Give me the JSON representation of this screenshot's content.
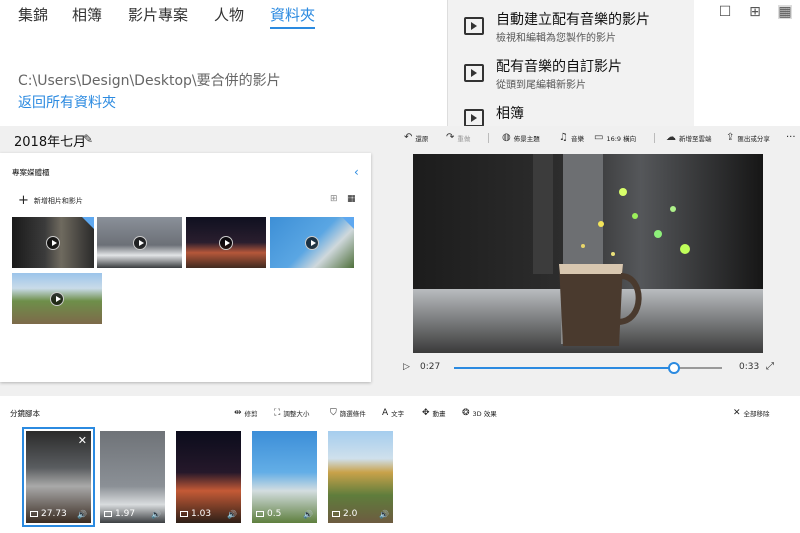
{
  "nav": {
    "tabs": [
      {
        "label": "集錦"
      },
      {
        "label": "相簿"
      },
      {
        "label": "影片專案"
      },
      {
        "label": "人物"
      },
      {
        "label": "資料夾"
      }
    ],
    "view_icons": [
      "square-view-icon",
      "grid-view-icon",
      "dense-grid-view-icon"
    ]
  },
  "folder": {
    "path": "C:\\Users\\Design\\Desktop\\要合併的影片",
    "back_label": "返回所有資料夾"
  },
  "menu": {
    "items": [
      {
        "title": "自動建立配有音樂的影片",
        "subtitle": "檢視和編輯為您製作的影片"
      },
      {
        "title": "配有音樂的自訂影片",
        "subtitle": "從頭到尾編輯新影片"
      },
      {
        "title": "相簿",
        "subtitle": ""
      }
    ]
  },
  "editor": {
    "project_title": "2018年七月",
    "toolbar": {
      "undo": "還原",
      "redo": "重做",
      "theme": "佈景主題",
      "music": "音樂",
      "aspect": "16:9 橫向",
      "cloud": "新增至雲端",
      "export": "匯出或分享",
      "more": "···"
    }
  },
  "library": {
    "title": "專案媒體櫃",
    "add_label": "新增相片和影片"
  },
  "player": {
    "current_time": "0:27",
    "end_time": "0:33",
    "progress": 0.82
  },
  "storyboard": {
    "title": "分鏡腳本",
    "tools": {
      "trim": "修剪",
      "resize": "調整大小",
      "filters": "篩選條件",
      "text": "文字",
      "motion": "動畫",
      "effects": "3D 效果",
      "remove_all": "全部移除"
    },
    "clips": [
      {
        "duration": "27.73"
      },
      {
        "duration": "1.97"
      },
      {
        "duration": "1.03"
      },
      {
        "duration": "0.5"
      },
      {
        "duration": "2.0"
      }
    ]
  },
  "colors": {
    "accent": "#2b8ae0",
    "menu_bg": "#f2f2f2",
    "editor_bg": "#f0f0f0"
  }
}
